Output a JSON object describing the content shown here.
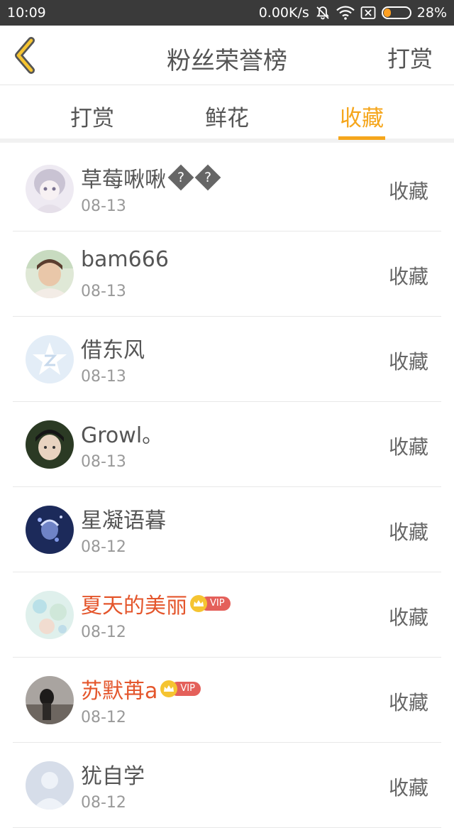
{
  "status_bar": {
    "time": "10:09",
    "network_speed": "0.00K/s",
    "battery": "28%",
    "battery_level": 0.28
  },
  "header": {
    "title": "粉丝荣誉榜",
    "action": "打赏"
  },
  "tabs": [
    {
      "label": "打赏",
      "active": false
    },
    {
      "label": "鲜花",
      "active": false
    },
    {
      "label": "收藏",
      "active": true
    }
  ],
  "colors": {
    "accent": "#f5a61c",
    "vip_name": "#e4562c",
    "text": "#555555",
    "date": "#999999"
  },
  "fans": [
    {
      "name": "草莓啾啾",
      "glyphs": [
        "?",
        "?"
      ],
      "date": "08-13",
      "action": "收藏",
      "vip": false
    },
    {
      "name": "bam666",
      "date": "08-13",
      "action": "收藏",
      "vip": false
    },
    {
      "name": "借东风",
      "date": "08-13",
      "action": "收藏",
      "vip": false
    },
    {
      "name": "Growl。",
      "date": "08-13",
      "action": "收藏",
      "vip": false
    },
    {
      "name": "星凝语暮",
      "date": "08-12",
      "action": "收藏",
      "vip": false
    },
    {
      "name": "夏天的美丽",
      "date": "08-12",
      "action": "收藏",
      "vip": true,
      "vip_label": "VIP"
    },
    {
      "name": "苏默苒a",
      "date": "08-12",
      "action": "收藏",
      "vip": true,
      "vip_label": "VIP"
    },
    {
      "name": "犹自学",
      "date": "08-12",
      "action": "收藏",
      "vip": false
    }
  ]
}
